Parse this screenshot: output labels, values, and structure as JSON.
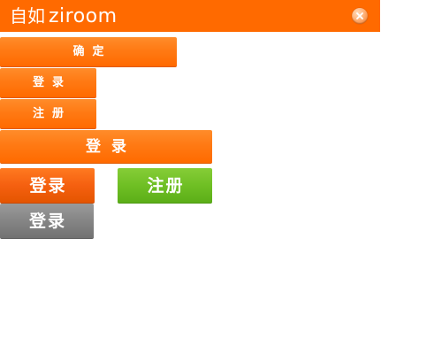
{
  "header": {
    "brand_cn": "自如",
    "brand_en": "ziroom",
    "close_icon": "close-icon"
  },
  "buttons": {
    "confirm": "确定",
    "login_small": "登录",
    "register_small": "注册",
    "login_wide": "登录",
    "login_large": "登录",
    "register_large": "注册",
    "login_disabled": "登录"
  },
  "colors": {
    "brand_orange": "#ff6a00",
    "button_orange": "#ff7a14",
    "button_green": "#6fbf24",
    "button_gray": "#858585"
  }
}
